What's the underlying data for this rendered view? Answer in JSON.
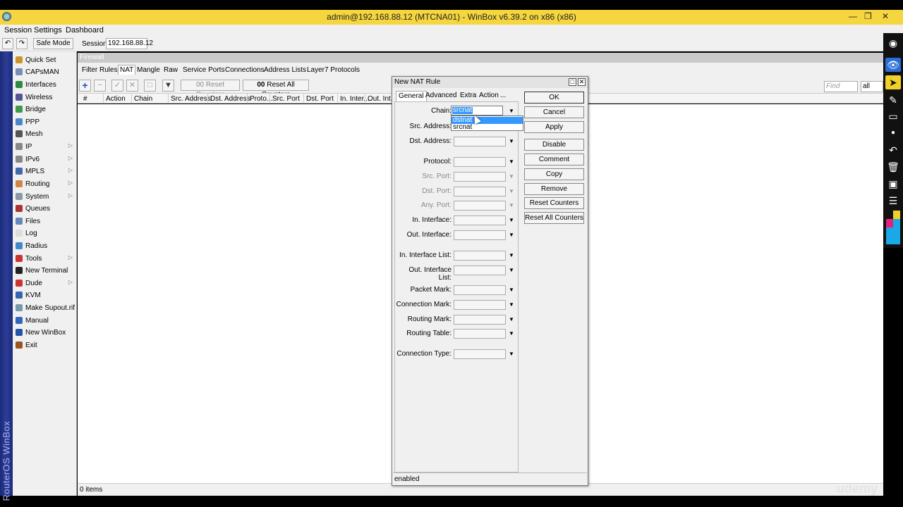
{
  "window": {
    "title": "admin@192.168.88.12 (MTCNA01) - WinBox v6.39.2 on x86 (x86)"
  },
  "menu": [
    "Session",
    "Settings",
    "Dashboard"
  ],
  "toolbar": {
    "safe_mode": "Safe Mode",
    "session_label": "Session:",
    "session_value": "192.168.88.12"
  },
  "vertical_brand": "RouterOS WinBox",
  "sidebar": {
    "items": [
      {
        "label": "Quick Set",
        "icon": "quick-set-icon",
        "color": "#c9962b",
        "arrow": false
      },
      {
        "label": "CAPsMAN",
        "icon": "capsman-icon",
        "color": "#7a8fb5",
        "arrow": false
      },
      {
        "label": "Interfaces",
        "icon": "interfaces-icon",
        "color": "#2d8a3e",
        "arrow": false
      },
      {
        "label": "Wireless",
        "icon": "wireless-icon",
        "color": "#555599",
        "arrow": false
      },
      {
        "label": "Bridge",
        "icon": "bridge-icon",
        "color": "#3d9a4e",
        "arrow": false
      },
      {
        "label": "PPP",
        "icon": "ppp-icon",
        "color": "#4b87c8",
        "arrow": false
      },
      {
        "label": "Mesh",
        "icon": "mesh-icon",
        "color": "#555555",
        "arrow": false
      },
      {
        "label": "IP",
        "icon": "ip-icon",
        "color": "#888888",
        "arrow": true
      },
      {
        "label": "IPv6",
        "icon": "ipv6-icon",
        "color": "#888888",
        "arrow": true
      },
      {
        "label": "MPLS",
        "icon": "mpls-icon",
        "color": "#4466aa",
        "arrow": true
      },
      {
        "label": "Routing",
        "icon": "routing-icon",
        "color": "#cc8844",
        "arrow": true
      },
      {
        "label": "System",
        "icon": "system-icon",
        "color": "#8899aa",
        "arrow": true
      },
      {
        "label": "Queues",
        "icon": "queues-icon",
        "color": "#aa3333",
        "arrow": false
      },
      {
        "label": "Files",
        "icon": "files-icon",
        "color": "#6688bb",
        "arrow": false
      },
      {
        "label": "Log",
        "icon": "log-icon",
        "color": "#dddddd",
        "arrow": false
      },
      {
        "label": "Radius",
        "icon": "radius-icon",
        "color": "#4488cc",
        "arrow": false
      },
      {
        "label": "Tools",
        "icon": "tools-icon",
        "color": "#cc3333",
        "arrow": true
      },
      {
        "label": "New Terminal",
        "icon": "terminal-icon",
        "color": "#222222",
        "arrow": false
      },
      {
        "label": "Dude",
        "icon": "dude-icon",
        "color": "#cc3333",
        "arrow": true
      },
      {
        "label": "KVM",
        "icon": "kvm-icon",
        "color": "#3366aa",
        "arrow": false
      },
      {
        "label": "Make Supout.rif",
        "icon": "supout-icon",
        "color": "#7799aa",
        "arrow": false
      },
      {
        "label": "Manual",
        "icon": "manual-icon",
        "color": "#3366bb",
        "arrow": false
      },
      {
        "label": "New WinBox",
        "icon": "winbox-icon",
        "color": "#2255aa",
        "arrow": false
      },
      {
        "label": "Exit",
        "icon": "exit-icon",
        "color": "#995522",
        "arrow": false
      }
    ]
  },
  "firewall": {
    "title": "Firewall",
    "tabs": [
      "Filter Rules",
      "NAT",
      "Mangle",
      "Raw",
      "Service Ports",
      "Connections",
      "Address Lists",
      "Layer7 Protocols"
    ],
    "active_tab": "NAT",
    "reset_counters": "Reset Counters",
    "reset_all_counters": "Reset All Counters",
    "columns": [
      "#",
      "Action",
      "Chain",
      "Src. Address",
      "Dst. Address",
      "Proto...",
      "Src. Port",
      "Dst. Port",
      "In. Inter...",
      "Out. Int..."
    ],
    "find_placeholder": "Find",
    "filter_value": "all",
    "status": "0 items"
  },
  "dialog": {
    "title": "New NAT Rule",
    "tabs": [
      "General",
      "Advanced",
      "Extra",
      "Action",
      "..."
    ],
    "active_tab": "General",
    "chain": {
      "label": "Chain:",
      "value": "srcnat",
      "options": [
        "dstnat",
        "srcnat"
      ],
      "highlighted": "dstnat"
    },
    "fields": [
      {
        "label": "Src. Address:",
        "dim": false
      },
      {
        "label": "Dst. Address:",
        "dim": false
      },
      {
        "label": "Protocol:",
        "dim": false
      },
      {
        "label": "Src. Port:",
        "dim": true
      },
      {
        "label": "Dst. Port:",
        "dim": true
      },
      {
        "label": "Any. Port:",
        "dim": true
      },
      {
        "label": "In. Interface:",
        "dim": false
      },
      {
        "label": "Out. Interface:",
        "dim": false
      },
      {
        "label": "In. Interface List:",
        "dim": false
      },
      {
        "label": "Out. Interface List:",
        "dim": false
      },
      {
        "label": "Packet Mark:",
        "dim": false
      },
      {
        "label": "Connection Mark:",
        "dim": false
      },
      {
        "label": "Routing Mark:",
        "dim": false
      },
      {
        "label": "Routing Table:",
        "dim": false
      },
      {
        "label": "Connection Type:",
        "dim": false
      }
    ],
    "buttons": [
      "OK",
      "Cancel",
      "Apply",
      "Disable",
      "Comment",
      "Copy",
      "Remove",
      "Reset Counters",
      "Reset All Counters"
    ],
    "status": "enabled"
  },
  "watermark": "udemy"
}
